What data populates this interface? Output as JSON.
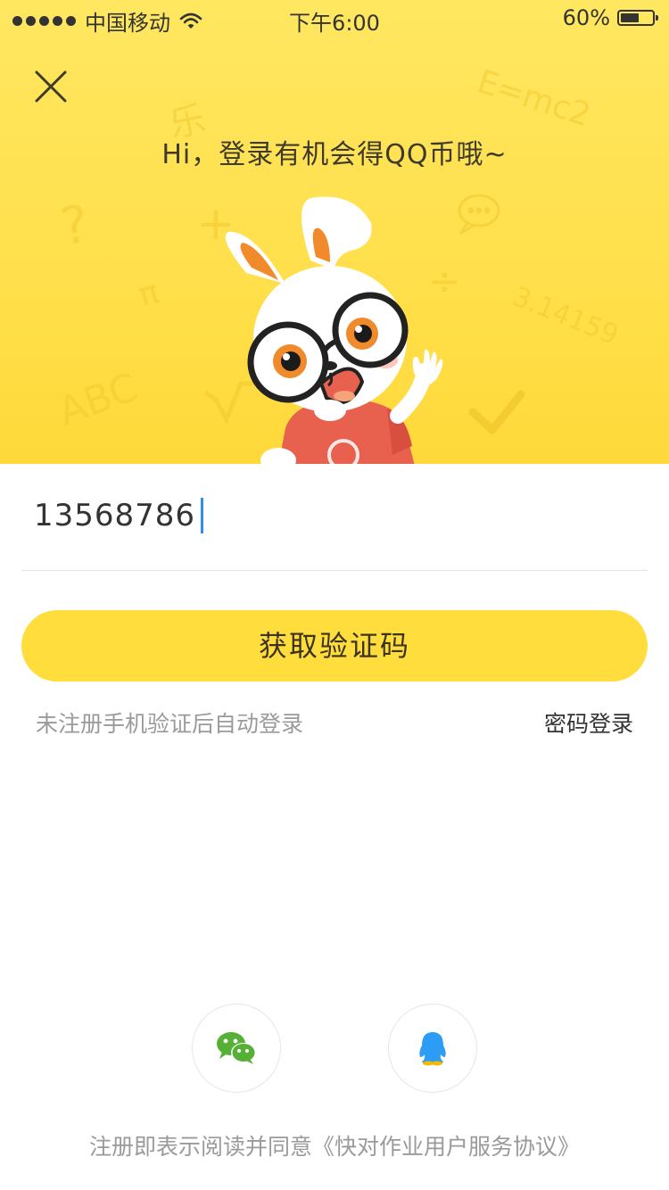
{
  "status_bar": {
    "carrier": "中国移动",
    "time": "下午6:00",
    "battery_percent": "60%",
    "battery_level": 0.6
  },
  "header": {
    "greeting": "Hi，登录有机会得QQ币哦~",
    "close_icon": "close-icon",
    "decorations": [
      "乐",
      "E=mc2",
      "?",
      "+",
      "π",
      "÷",
      "3.14159",
      "ABC"
    ]
  },
  "form": {
    "phone_value": "13568786",
    "get_code_label": "获取验证码",
    "hint": "未注册手机验证后自动登录",
    "password_login_label": "密码登录"
  },
  "social": {
    "items": [
      {
        "icon": "wechat-icon",
        "color": "#56B036"
      },
      {
        "icon": "qq-icon",
        "color": "#2D9CF5"
      }
    ]
  },
  "footer": {
    "agreement_prefix": "注册即表示阅读并同意",
    "agreement_link": "《快对作业用户服务协议》"
  },
  "colors": {
    "accent_yellow": "#FFDD3C",
    "caret_blue": "#2F8FF0",
    "hint_gray": "#9A9A9A"
  }
}
